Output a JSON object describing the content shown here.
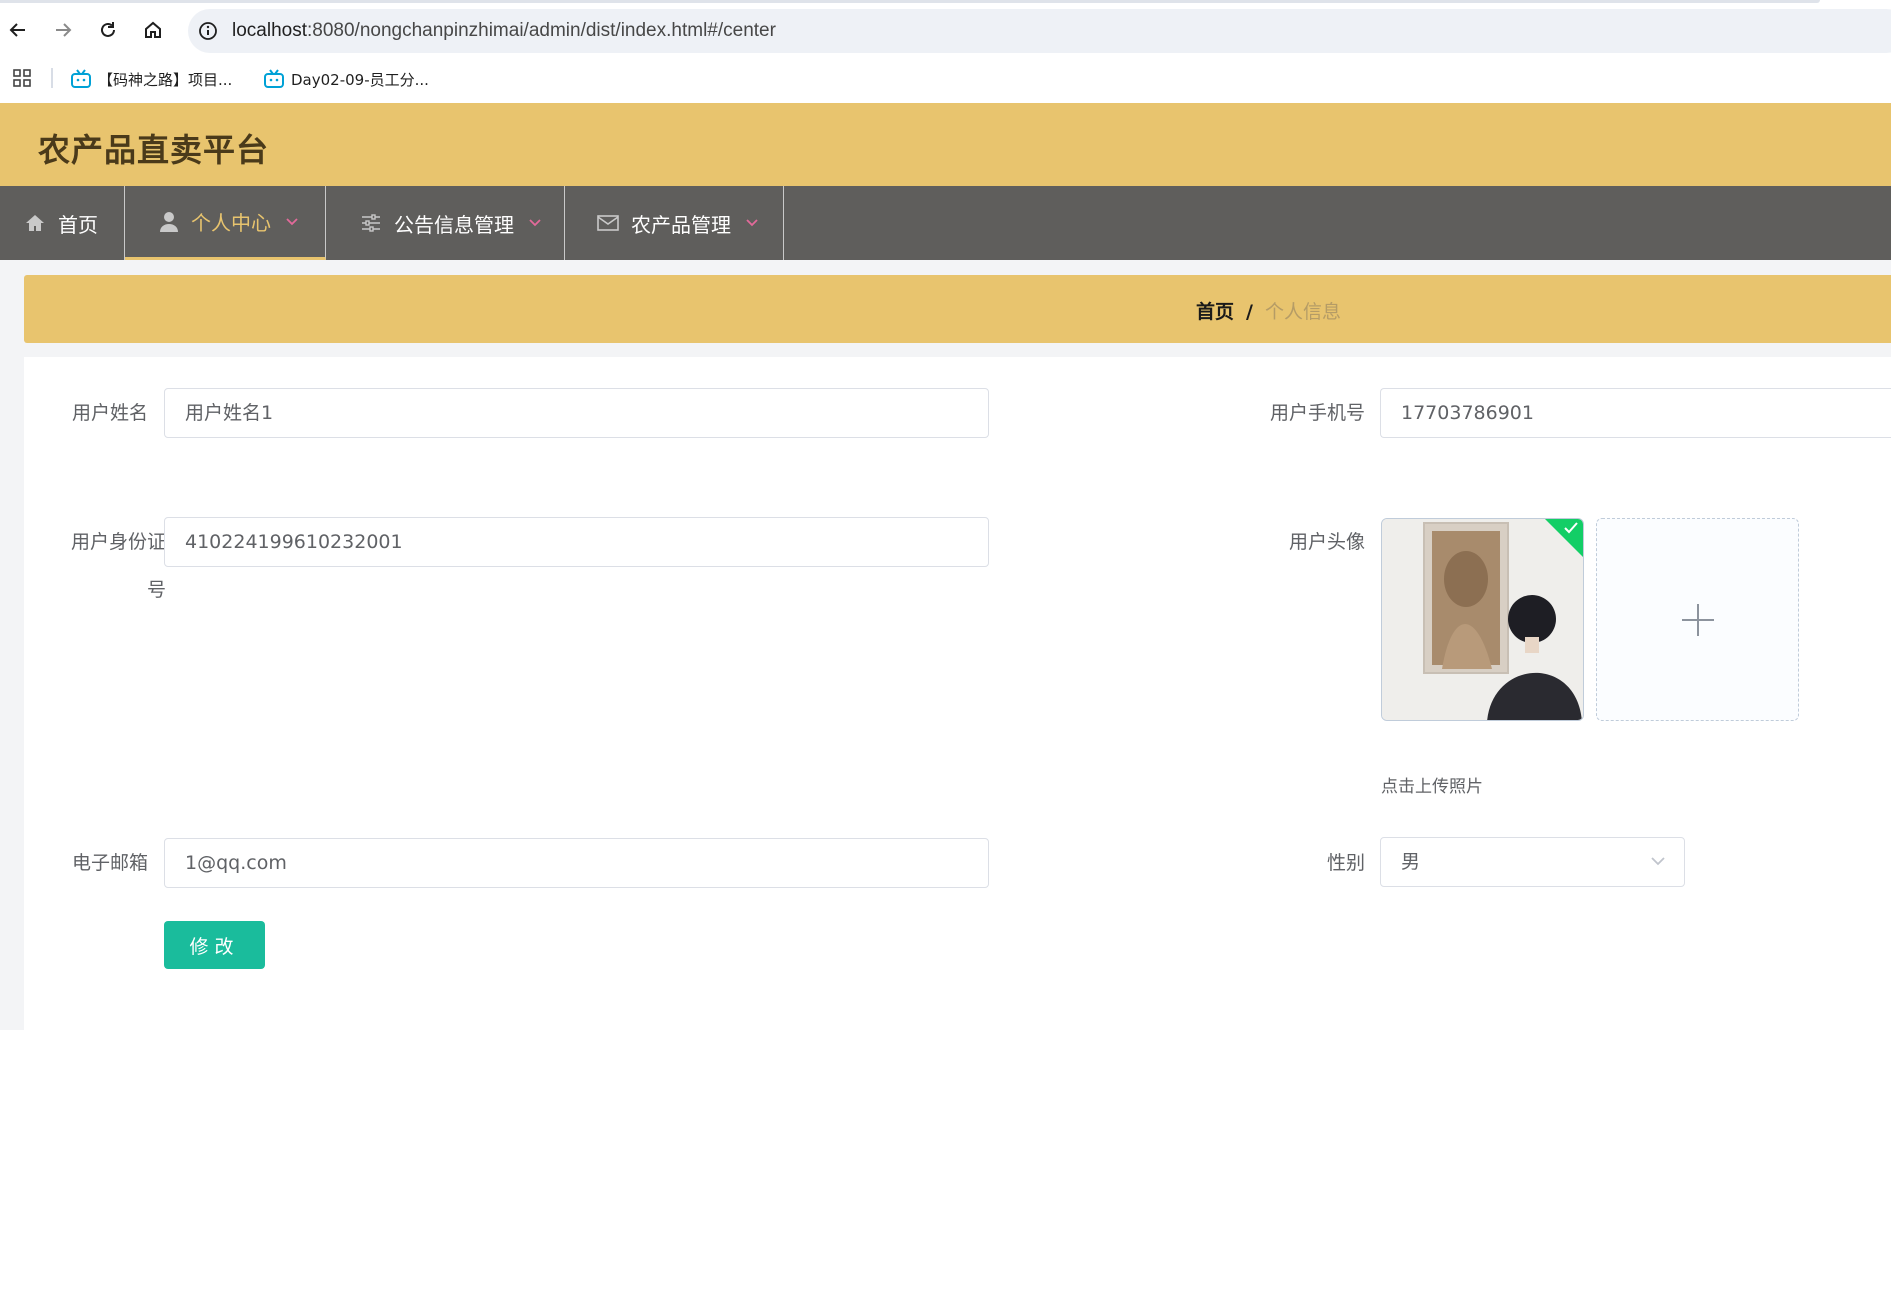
{
  "browser": {
    "url_host": "localhost",
    "url_rest": ":8080/nongchanpinzhimai/admin/dist/index.html#/center",
    "bookmarks": [
      {
        "label": "【码神之路】项目..."
      },
      {
        "label": "Day02-09-员工分..."
      }
    ]
  },
  "header": {
    "title": "农产品直卖平台"
  },
  "menu": {
    "items": [
      {
        "label": "首页",
        "icon": "home-icon"
      },
      {
        "label": "个人中心",
        "icon": "user-icon"
      },
      {
        "label": "公告信息管理",
        "icon": "sliders-icon"
      },
      {
        "label": "农产品管理",
        "icon": "mail-icon"
      }
    ]
  },
  "breadcrumb": {
    "home": "首页",
    "separator": "/",
    "current": "个人信息"
  },
  "form": {
    "username": {
      "label": "用户姓名",
      "value": "用户姓名1"
    },
    "phone": {
      "label": "用户手机号",
      "value": "17703786901"
    },
    "id_number": {
      "label": "用户身份证号",
      "value": "410224199610232001"
    },
    "avatar": {
      "label": "用户头像",
      "upload_tip": "点击上传照片"
    },
    "email": {
      "label": "电子邮箱",
      "value": "1@qq.com"
    },
    "gender": {
      "label": "性别",
      "value": "男"
    },
    "submit_label": "修改"
  },
  "colors": {
    "header_bg": "#e8c46e",
    "menu_bg": "#5f5e5c",
    "button_bg": "#1abc9c",
    "success": "#13ce66"
  }
}
